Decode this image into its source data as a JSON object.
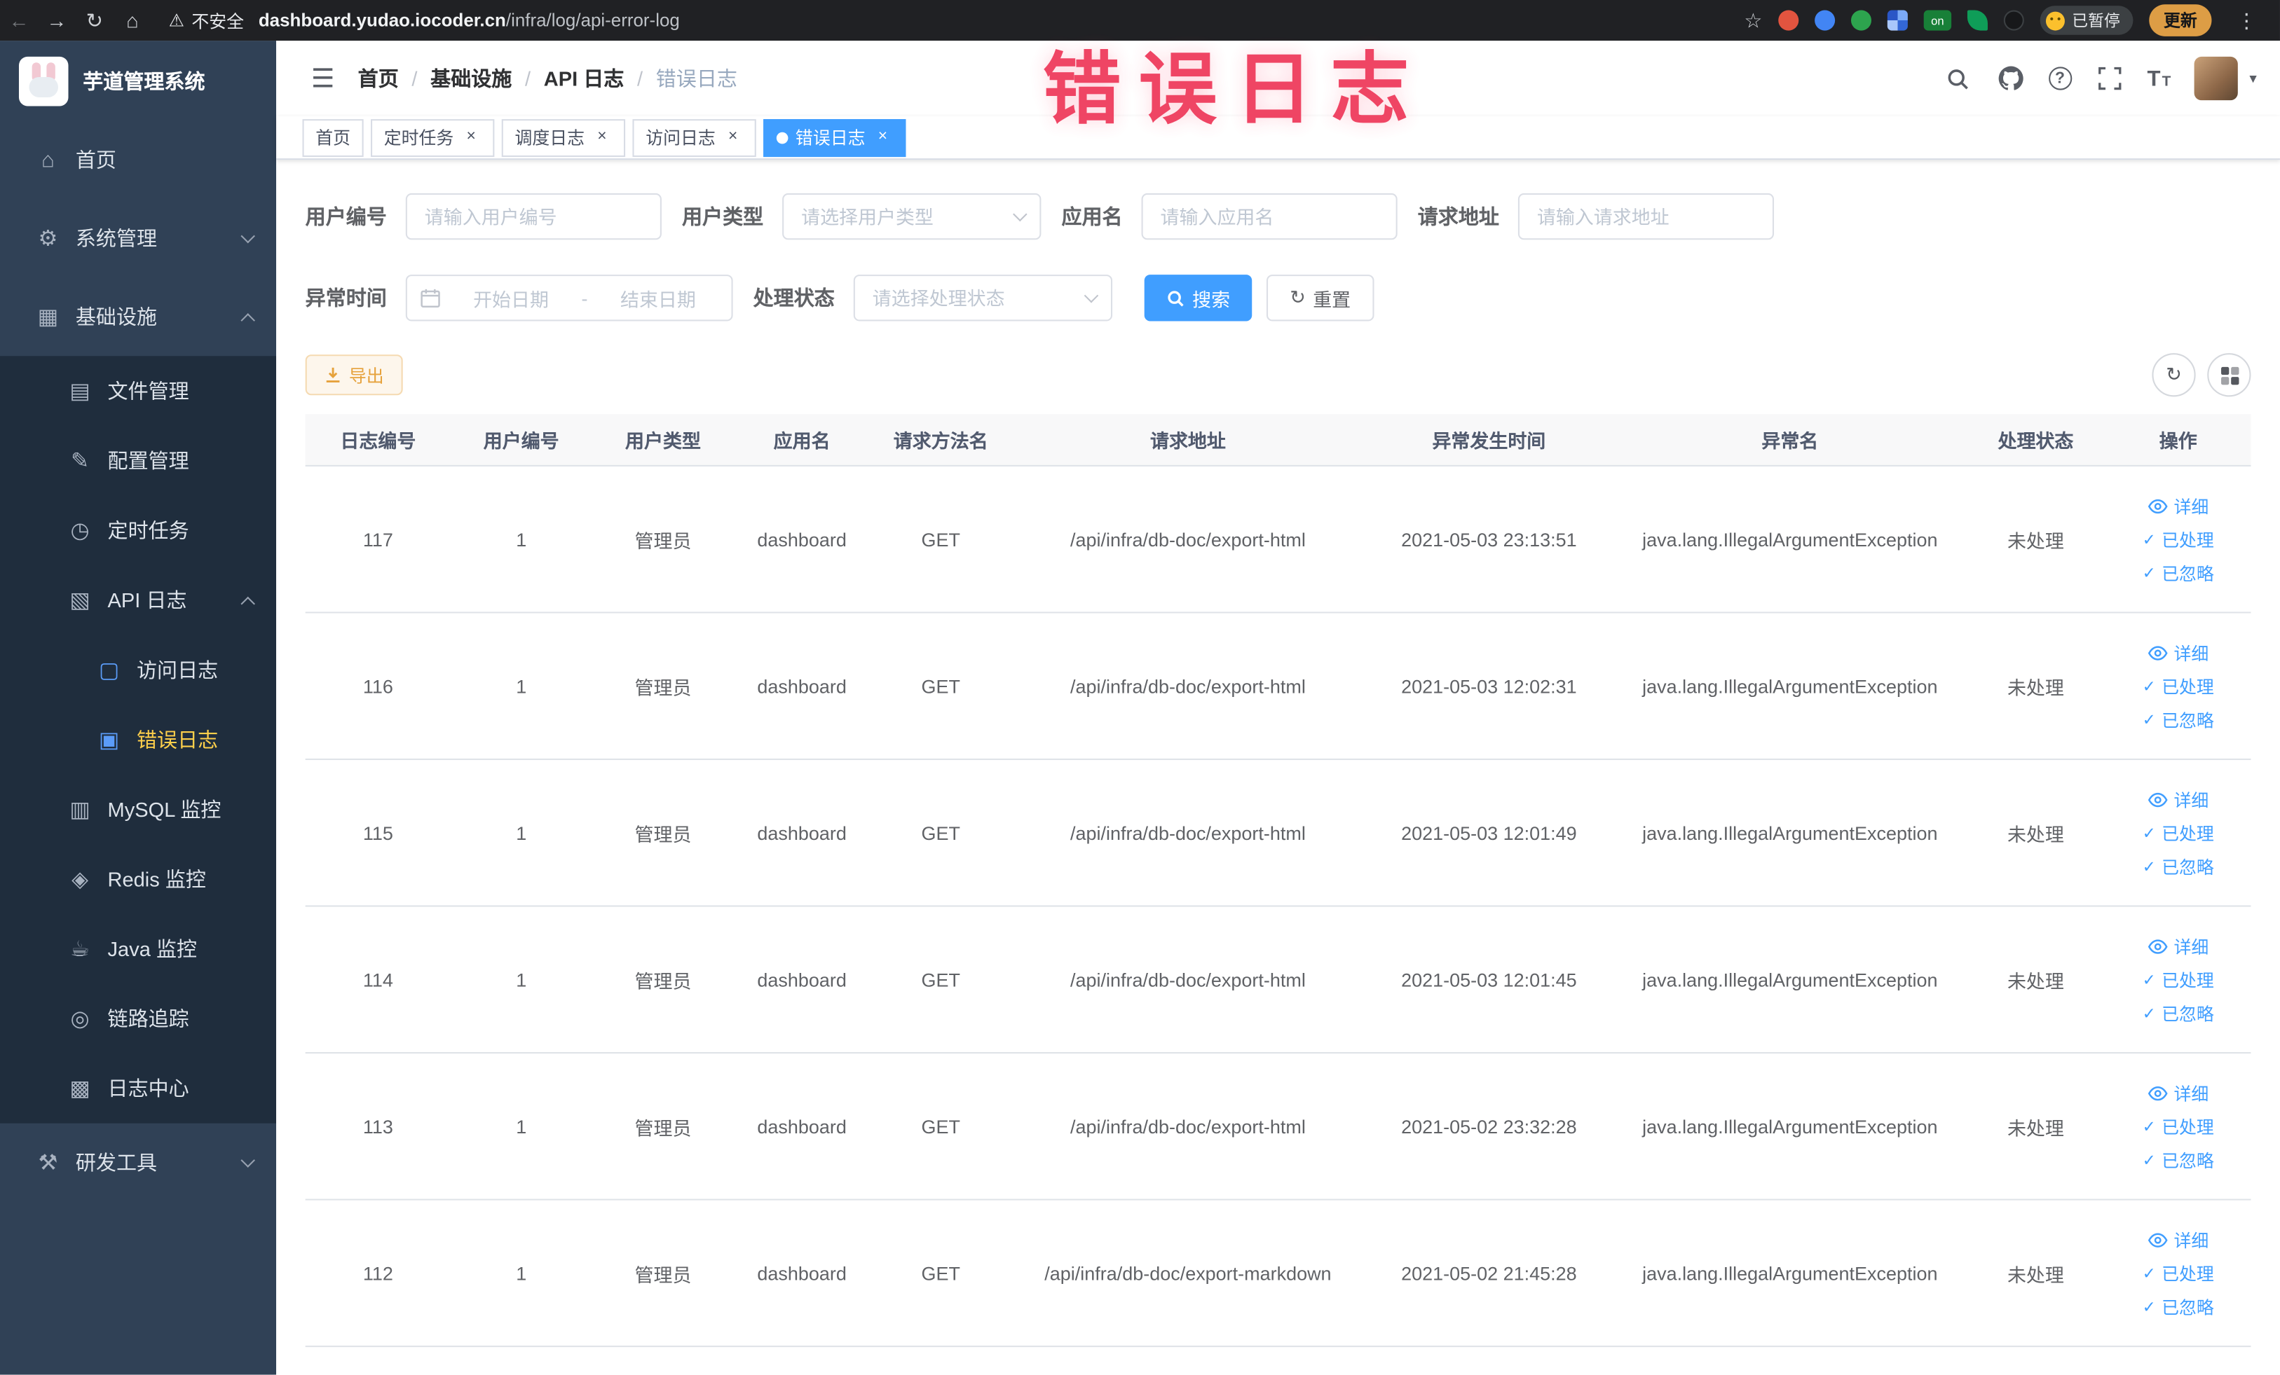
{
  "chrome": {
    "security_label": "不安全",
    "url_domain": "dashboard.yudao.iocoder.cn",
    "url_path": "/infra/log/api-error-log",
    "profile_badge": "已暂停",
    "update_button": "更新",
    "extension_badge_on": "on"
  },
  "watermark": "错误日志",
  "sidebar": {
    "logo_title": "芋道管理系统",
    "items": [
      {
        "label": "首页",
        "icon": "⌂"
      },
      {
        "label": "系统管理",
        "icon": "⚙"
      },
      {
        "label": "基础设施",
        "icon": "▦"
      },
      {
        "label": "文件管理",
        "icon": "▤"
      },
      {
        "label": "配置管理",
        "icon": "✎"
      },
      {
        "label": "定时任务",
        "icon": "◷"
      },
      {
        "label": "API 日志",
        "icon": "▧"
      },
      {
        "label": "访问日志",
        "icon": "▢"
      },
      {
        "label": "错误日志",
        "icon": "▣"
      },
      {
        "label": "MySQL 监控",
        "icon": "▥"
      },
      {
        "label": "Redis 监控",
        "icon": "◈"
      },
      {
        "label": "Java 监控",
        "icon": "☕"
      },
      {
        "label": "链路追踪",
        "icon": "◎"
      },
      {
        "label": "日志中心",
        "icon": "▩"
      },
      {
        "label": "研发工具",
        "icon": "⚒"
      }
    ]
  },
  "header": {
    "breadcrumb": [
      "首页",
      "基础设施",
      "API 日志",
      "错误日志"
    ],
    "separator": "/"
  },
  "tabs": [
    {
      "label": "首页"
    },
    {
      "label": "定时任务"
    },
    {
      "label": "调度日志"
    },
    {
      "label": "访问日志"
    },
    {
      "label": "错误日志"
    }
  ],
  "filters": {
    "user_id_label": "用户编号",
    "user_id_placeholder": "请输入用户编号",
    "user_type_label": "用户类型",
    "user_type_placeholder": "请选择用户类型",
    "app_name_label": "应用名",
    "app_name_placeholder": "请输入应用名",
    "request_url_label": "请求地址",
    "request_url_placeholder": "请输入请求地址",
    "time_label": "异常时间",
    "time_start_placeholder": "开始日期",
    "time_separator": "-",
    "time_end_placeholder": "结束日期",
    "status_label": "处理状态",
    "status_placeholder": "请选择处理状态",
    "search_button": "搜索",
    "reset_button": "重置"
  },
  "toolbar": {
    "export_button": "导出"
  },
  "table": {
    "columns": [
      "日志编号",
      "用户编号",
      "用户类型",
      "应用名",
      "请求方法名",
      "请求地址",
      "异常发生时间",
      "异常名",
      "处理状态",
      "操作"
    ],
    "actions": [
      "详细",
      "已处理",
      "已忽略"
    ],
    "rows": [
      {
        "id": "117",
        "user_id": "1",
        "user_type": "管理员",
        "app": "dashboard",
        "method": "GET",
        "url": "/api/infra/db-doc/export-html",
        "time": "2021-05-03 23:13:51",
        "exception": "java.lang.IllegalArgumentException",
        "status": "未处理"
      },
      {
        "id": "116",
        "user_id": "1",
        "user_type": "管理员",
        "app": "dashboard",
        "method": "GET",
        "url": "/api/infra/db-doc/export-html",
        "time": "2021-05-03 12:02:31",
        "exception": "java.lang.IllegalArgumentException",
        "status": "未处理"
      },
      {
        "id": "115",
        "user_id": "1",
        "user_type": "管理员",
        "app": "dashboard",
        "method": "GET",
        "url": "/api/infra/db-doc/export-html",
        "time": "2021-05-03 12:01:49",
        "exception": "java.lang.IllegalArgumentException",
        "status": "未处理"
      },
      {
        "id": "114",
        "user_id": "1",
        "user_type": "管理员",
        "app": "dashboard",
        "method": "GET",
        "url": "/api/infra/db-doc/export-html",
        "time": "2021-05-03 12:01:45",
        "exception": "java.lang.IllegalArgumentException",
        "status": "未处理"
      },
      {
        "id": "113",
        "user_id": "1",
        "user_type": "管理员",
        "app": "dashboard",
        "method": "GET",
        "url": "/api/infra/db-doc/export-html",
        "time": "2021-05-02 23:32:28",
        "exception": "java.lang.IllegalArgumentException",
        "status": "未处理"
      },
      {
        "id": "112",
        "user_id": "1",
        "user_type": "管理员",
        "app": "dashboard",
        "method": "GET",
        "url": "/api/infra/db-doc/export-markdown",
        "time": "2021-05-02 21:45:28",
        "exception": "java.lang.IllegalArgumentException",
        "status": "未处理"
      }
    ]
  },
  "icons": {
    "back": "←",
    "forward": "→",
    "reload": "↻",
    "home": "⌂",
    "warning": "⚠",
    "star": "☆",
    "menu_dots": "⋮",
    "hamburger": "☰",
    "question": "?",
    "font_size": "T",
    "close": "×",
    "check": "✓",
    "refresh": "↻",
    "caret": "▾"
  },
  "colors": {
    "primary": "#409eff",
    "sidebar_bg": "#304156",
    "submenu_bg": "#1f2d3d",
    "active_menu_text": "#ffd04b",
    "warning": "#e6a23c",
    "watermark": "#ee3154"
  }
}
